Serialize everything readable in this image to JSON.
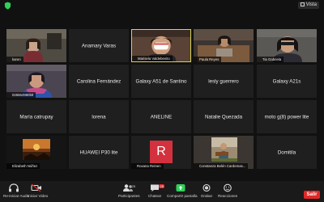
{
  "topbar": {
    "view_label": "Vista"
  },
  "tiles": [
    {
      "row": 0,
      "col": 0,
      "kind": "video",
      "label": "karen"
    },
    {
      "row": 0,
      "col": 1,
      "kind": "name",
      "name": "Anamary Varas"
    },
    {
      "row": 0,
      "col": 2,
      "kind": "video",
      "label": "Marisela Valdebenito",
      "active": true
    },
    {
      "row": 0,
      "col": 3,
      "kind": "video",
      "label": "Paula Reyes"
    },
    {
      "row": 0,
      "col": 4,
      "kind": "video",
      "label": "Tia Gabriela"
    },
    {
      "row": 1,
      "col": 0,
      "kind": "video",
      "label": "02656498059"
    },
    {
      "row": 1,
      "col": 1,
      "kind": "name",
      "name": "Carolina Fernández"
    },
    {
      "row": 1,
      "col": 2,
      "kind": "name",
      "name": "Galaxy A51 de Santino"
    },
    {
      "row": 1,
      "col": 3,
      "kind": "name",
      "name": "lesly guerrero"
    },
    {
      "row": 1,
      "col": 4,
      "kind": "name",
      "name": "Galaxy A21s"
    },
    {
      "row": 2,
      "col": 0,
      "kind": "name",
      "name": "María catrupay"
    },
    {
      "row": 2,
      "col": 1,
      "kind": "name",
      "name": "lorena"
    },
    {
      "row": 2,
      "col": 2,
      "kind": "name",
      "name": "ANELINE"
    },
    {
      "row": 2,
      "col": 3,
      "kind": "name",
      "name": "Natalie Quezada"
    },
    {
      "row": 2,
      "col": 4,
      "kind": "name",
      "name": "moto g(8) power lite"
    },
    {
      "row": 3,
      "col": 0,
      "kind": "video",
      "label": "Elizabeth Núñez"
    },
    {
      "row": 3,
      "col": 1,
      "kind": "name",
      "name": "HUAWEI P30 lite"
    },
    {
      "row": 3,
      "col": 2,
      "kind": "avatar",
      "label": "Roxana Reinen",
      "initial": "R"
    },
    {
      "row": 3,
      "col": 3,
      "kind": "video",
      "label": "Constanza Belén Cardemas..."
    },
    {
      "row": 3,
      "col": 4,
      "kind": "name",
      "name": "Domitila"
    }
  ],
  "toolbar": {
    "mute_label": "Re-iniciar Audio",
    "video_label": "Iniciar Video",
    "participants_label": "Participantes",
    "participants_count": "25",
    "chat_label": "Chatear",
    "chat_badge": "25",
    "share_label": "Compartir pantalla",
    "record_label": "Grabar",
    "reactions_label": "Reacciones",
    "leave_label": "Salir"
  },
  "colors": {
    "background": "#111111",
    "tile": "#1f1f1f",
    "active_border": "#d8d255",
    "share_green": "#2fd05a",
    "leave_red": "#e02828",
    "avatar_red": "#d3313d"
  }
}
